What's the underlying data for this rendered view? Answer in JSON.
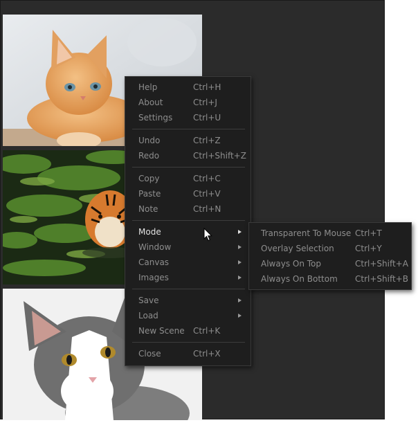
{
  "main_menu": {
    "groups": [
      [
        {
          "label": "Help",
          "shortcut": "Ctrl+H"
        },
        {
          "label": "About",
          "shortcut": "Ctrl+J"
        },
        {
          "label": "Settings",
          "shortcut": "Ctrl+U"
        }
      ],
      [
        {
          "label": "Undo",
          "shortcut": "Ctrl+Z"
        },
        {
          "label": "Redo",
          "shortcut": "Ctrl+Shift+Z"
        }
      ],
      [
        {
          "label": "Copy",
          "shortcut": "Ctrl+C"
        },
        {
          "label": "Paste",
          "shortcut": "Ctrl+V"
        },
        {
          "label": "Note",
          "shortcut": "Ctrl+N"
        }
      ],
      [
        {
          "label": "Mode",
          "submenu": true,
          "active": true
        },
        {
          "label": "Window",
          "submenu": true
        },
        {
          "label": "Canvas",
          "submenu": true
        },
        {
          "label": "Images",
          "submenu": true
        }
      ],
      [
        {
          "label": "Save",
          "submenu": true
        },
        {
          "label": "Load",
          "submenu": true
        },
        {
          "label": "New Scene",
          "shortcut": "Ctrl+K"
        }
      ],
      [
        {
          "label": "Close",
          "shortcut": "Ctrl+X"
        }
      ]
    ]
  },
  "mode_submenu": {
    "items": [
      {
        "label": "Transparent To Mouse",
        "shortcut": "Ctrl+T"
      },
      {
        "label": "Overlay Selection",
        "shortcut": "Ctrl+Y"
      },
      {
        "label": "Always On Top",
        "shortcut": "Ctrl+Shift+A"
      },
      {
        "label": "Always On Bottom",
        "shortcut": "Ctrl+Shift+B"
      }
    ]
  },
  "images": [
    "kitten-photo",
    "tiger-photo",
    "cat-photo"
  ],
  "colors": {
    "canvas_bg": "#2b2b2b",
    "menu_bg": "#1e1e1e",
    "menu_text": "#8e8e8e",
    "menu_text_active": "#e3e3e3"
  }
}
